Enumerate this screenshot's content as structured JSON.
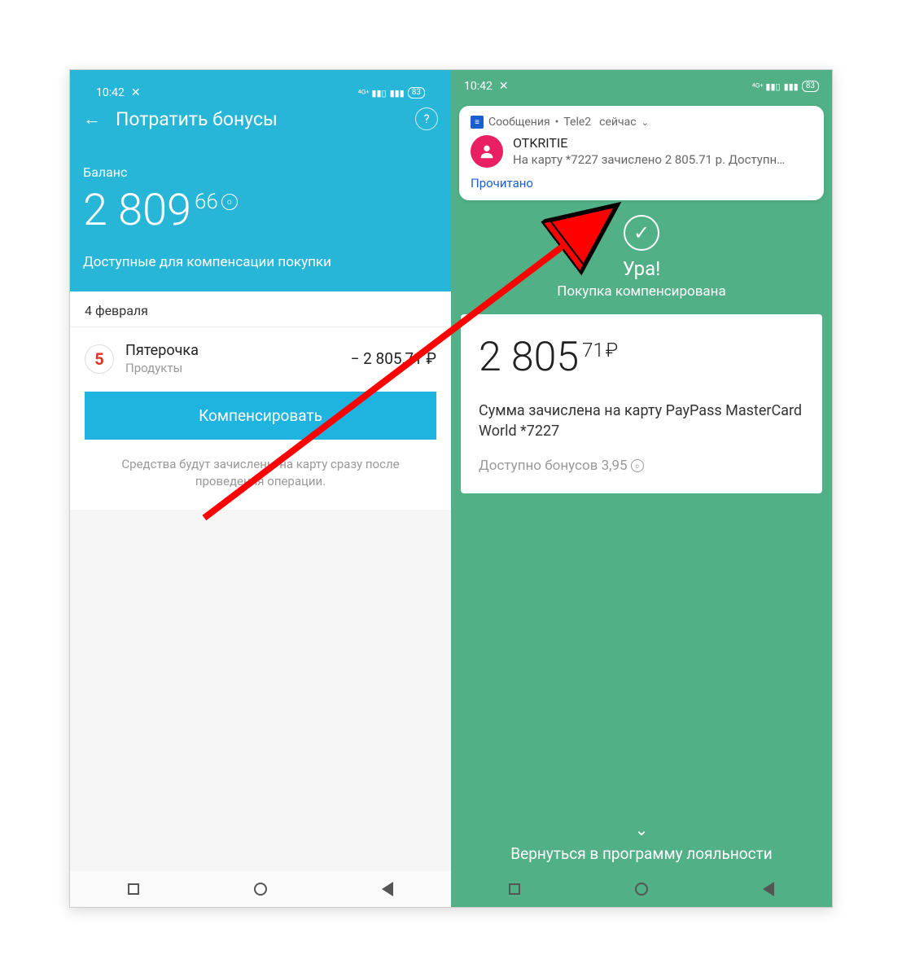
{
  "statusbar": {
    "time": "10:42",
    "battery": "83"
  },
  "left": {
    "header_title": "Потратить бонусы",
    "balance_label": "Баланс",
    "balance_int": "2 809",
    "balance_frac": "66",
    "available_text": "Доступные для компенсации покупки",
    "date": "4 февраля",
    "tx": {
      "merchant": "Пятерочка",
      "category": "Продукты",
      "amount": "− 2 805,71 ₽"
    },
    "compensate_btn": "Компенсировать",
    "hint": "Средства будут зачислены на карту сразу после проведения операции."
  },
  "right": {
    "notif": {
      "app": "Сообщения",
      "carrier": "Tele2",
      "when": "сейчас",
      "sender": "OTKRITIE",
      "message": "На карту *7227 зачислено 2 805.71 р. Доступно ...",
      "action": "Прочитано"
    },
    "success_title": "Ура!",
    "success_sub": "Покупка компенсирована",
    "amount_int": "2 805",
    "amount_frac": "71",
    "currency": "₽",
    "credited_text": "Сумма зачислена на карту PayPass MasterCard World *7227",
    "bonus_left": "Доступно бонусов 3,95",
    "return_link": "Вернуться в программу лояльности"
  }
}
